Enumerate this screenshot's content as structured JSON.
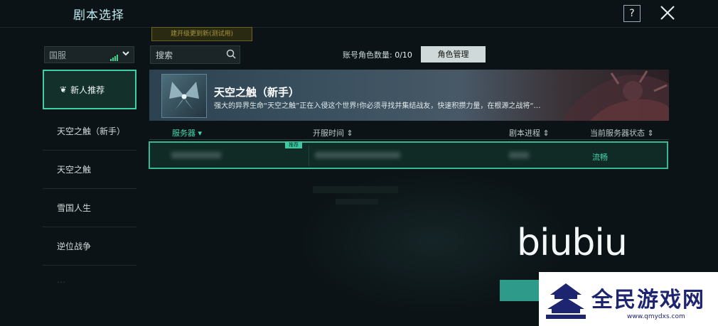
{
  "header": {
    "title": "剧本选择",
    "help_label": "?"
  },
  "hint_bar": "建开级更到新(测试用)",
  "region": {
    "label": "国服"
  },
  "sidebar": {
    "items": [
      {
        "label": "新人推荐",
        "active": true
      },
      {
        "label": "天空之触（新手）"
      },
      {
        "label": "天空之触"
      },
      {
        "label": "雪国人生"
      },
      {
        "label": "逆位战争"
      },
      {
        "label": "…"
      }
    ]
  },
  "search": {
    "placeholder": "搜索"
  },
  "account": {
    "label": "账号角色数量: ",
    "count": "0/10"
  },
  "role_button": "角色管理",
  "banner": {
    "title": "天空之触（新手）",
    "description": "强大的异界生命“天空之触”正在入侵这个世界!你必须寻找并集结战友，快速积攒力量，在根源之战将“…"
  },
  "table": {
    "headers": [
      "服务器",
      "开服时间",
      "剧本进程",
      "当前服务器状态"
    ],
    "row": {
      "badge": "推荐",
      "status": "流畅"
    }
  },
  "watermark": "biubiu",
  "brand": {
    "name": "全民游戏网",
    "url": "www.qmydxs.com"
  },
  "colors": {
    "accent": "#3fcfa6",
    "status_ok": "#42d4ab",
    "background": "#0b1316"
  }
}
